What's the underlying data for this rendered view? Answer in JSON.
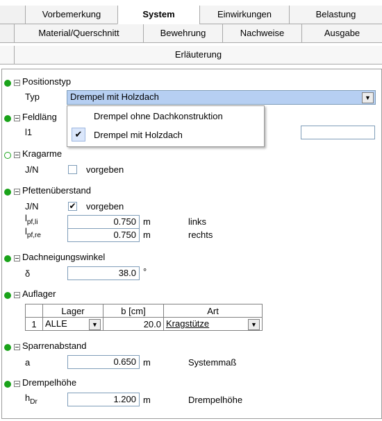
{
  "tabs": {
    "row1": [
      "Vorbemerkung",
      "System",
      "Einwirkungen",
      "Belastung"
    ],
    "row2": [
      "Material/Querschnitt",
      "Bewehrung",
      "Nachweise",
      "Ausgabe"
    ],
    "row3": [
      "Erläuterung"
    ]
  },
  "colors": {
    "status_green": "#1aa31a",
    "selection_blue": "#b6cff2"
  },
  "positionstyp": {
    "title": "Positionstyp",
    "typ_label": "Typ",
    "typ_value": "Drempel mit Holzdach",
    "options": [
      "Drempel ohne Dachkonstruktion",
      "Drempel mit Holzdach"
    ]
  },
  "feldlaenge": {
    "title": "Feldläng",
    "l1_label": "l1"
  },
  "kragarme": {
    "title": "Kragarme",
    "jn_label": "J/N",
    "check_label": "vorgeben",
    "checked": false
  },
  "pfetten": {
    "title": "Pfettenüberstand",
    "jn_label": "J/N",
    "check_label": "vorgeben",
    "checked": true,
    "li_label": "l",
    "li_sub": "pf,li",
    "li_value": "0.750",
    "li_unit": "m",
    "li_note": "links",
    "re_label": "l",
    "re_sub": "pf,re",
    "re_value": "0.750",
    "re_unit": "m",
    "re_note": "rechts"
  },
  "dachneigung": {
    "title": "Dachneigungswinkel",
    "label": "δ",
    "value": "38.0",
    "unit": "°"
  },
  "auflager": {
    "title": "Auflager",
    "headers": [
      "Lager",
      "b [cm]",
      "Art"
    ],
    "rows": [
      {
        "nr": "1",
        "lager": "ALLE",
        "b": "20.0",
        "art": "Kragstütze"
      }
    ]
  },
  "sparren": {
    "title": "Sparrenabstand",
    "label": "a",
    "value": "0.650",
    "unit": "m",
    "note": "Systemmaß"
  },
  "drempel": {
    "title": "Drempelhöhe",
    "label": "h",
    "sub": "Dr",
    "value": "1.200",
    "unit": "m",
    "note": "Drempelhöhe"
  }
}
